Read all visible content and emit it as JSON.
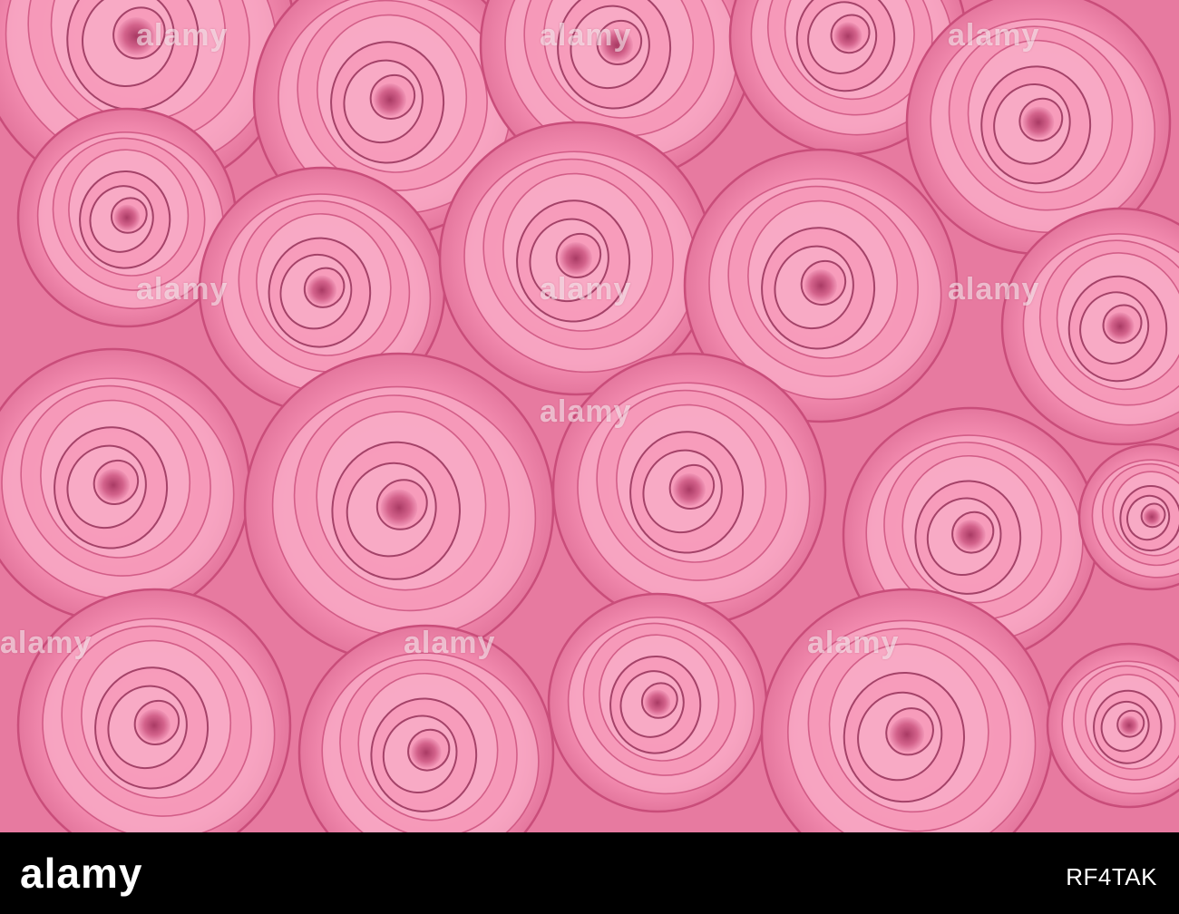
{
  "image": {
    "subject": "pink roses",
    "palette": {
      "base": "#f58fb2",
      "light": "#f9b6ce",
      "mid": "#ee7ca2",
      "shadow": "#c94d7a",
      "deep": "#8e2a52",
      "footer": "#000000"
    }
  },
  "watermark": {
    "text": "alamy"
  },
  "footer": {
    "logo": "alamy",
    "image_code": "RF4TAK"
  }
}
